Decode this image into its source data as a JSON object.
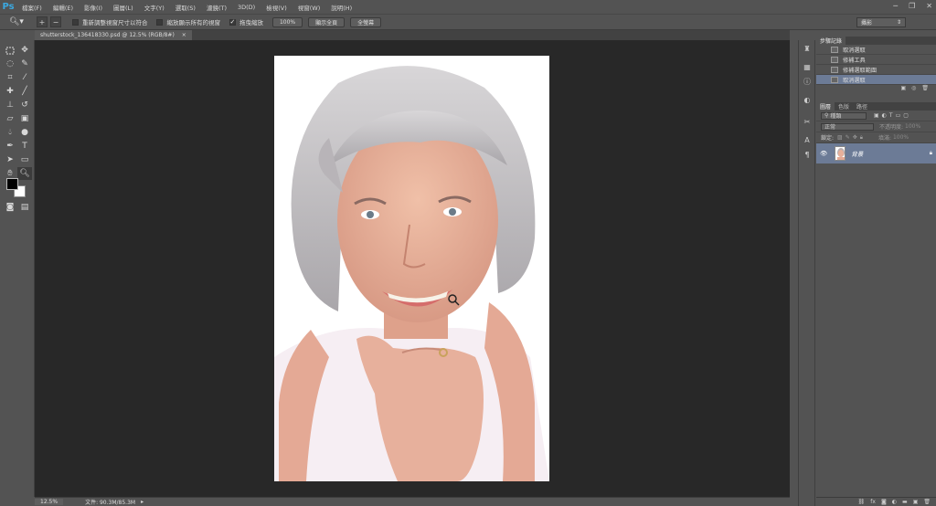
{
  "app": {
    "logo": "Ps"
  },
  "menu": [
    "檔案(F)",
    "編輯(E)",
    "影像(I)",
    "圖層(L)",
    "文字(Y)",
    "選取(S)",
    "濾鏡(T)",
    "3D(D)",
    "檢視(V)",
    "視窗(W)",
    "說明(H)"
  ],
  "window_controls": {
    "minimize": "─",
    "restore": "❐",
    "close": "✕"
  },
  "options_bar": {
    "resize_windows_label": "重新調整視窗尺寸以符合",
    "zoom_all_label": "縮放顯示所有的視窗",
    "scrubby_zoom_label": "拖曳縮放",
    "btn_100": "100%",
    "btn_fit": "顯示全頁",
    "btn_fill": "全螢幕",
    "workspace": "攝影"
  },
  "document": {
    "tab_title": "shutterstock_136418330.psd @ 12.5% (RGB/8#)",
    "tab_close": "×"
  },
  "status": {
    "zoom": "12.5%",
    "doc_size": "文件: 90.3M/85.3M"
  },
  "history": {
    "tabs": [
      "步驟記錄"
    ],
    "items": [
      {
        "label": "取消選取"
      },
      {
        "label": "修補工具"
      },
      {
        "label": "修補選取範圍"
      },
      {
        "label": "取消選取"
      }
    ]
  },
  "layers": {
    "tabs": [
      "圖層",
      "色版",
      "路徑"
    ],
    "filter": "種類",
    "blend": "正常",
    "opacity_label": "不透明度:",
    "opacity_value": "100%",
    "lock_label": "鎖定:",
    "fill_label": "填滿:",
    "fill_value": "100%",
    "layer_name": "背景"
  }
}
